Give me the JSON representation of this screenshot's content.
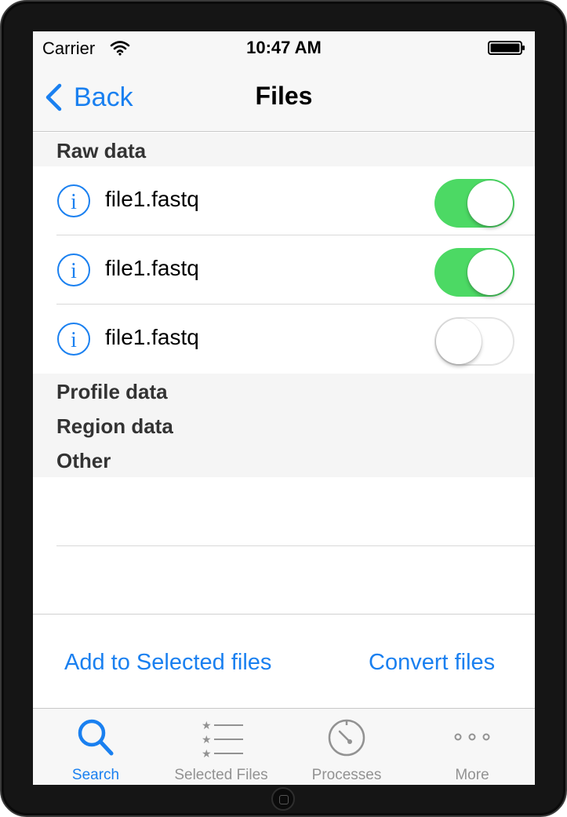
{
  "status_bar": {
    "carrier": "Carrier",
    "time": "10:47 AM"
  },
  "nav": {
    "back_label": "Back",
    "title": "Files"
  },
  "sections": {
    "raw_data": "Raw data",
    "profile_data": "Profile data",
    "region_data": "Region data",
    "other": "Other"
  },
  "files": [
    {
      "name": "file1.fastq",
      "selected": true
    },
    {
      "name": "file1.fastq",
      "selected": true
    },
    {
      "name": "file1.fastq",
      "selected": false
    }
  ],
  "actions": {
    "add_selected": "Add to Selected files",
    "convert": "Convert files"
  },
  "tabs": [
    {
      "label": "Search",
      "icon": "search-icon",
      "active": true
    },
    {
      "label": "Selected Files",
      "icon": "starred-list-icon",
      "active": false
    },
    {
      "label": "Processes",
      "icon": "gauge-icon",
      "active": false
    },
    {
      "label": "More",
      "icon": "more-dots-icon",
      "active": false
    }
  ],
  "colors": {
    "accent": "#1a80f0",
    "switch_on": "#4cd964",
    "tab_inactive": "#929292"
  }
}
